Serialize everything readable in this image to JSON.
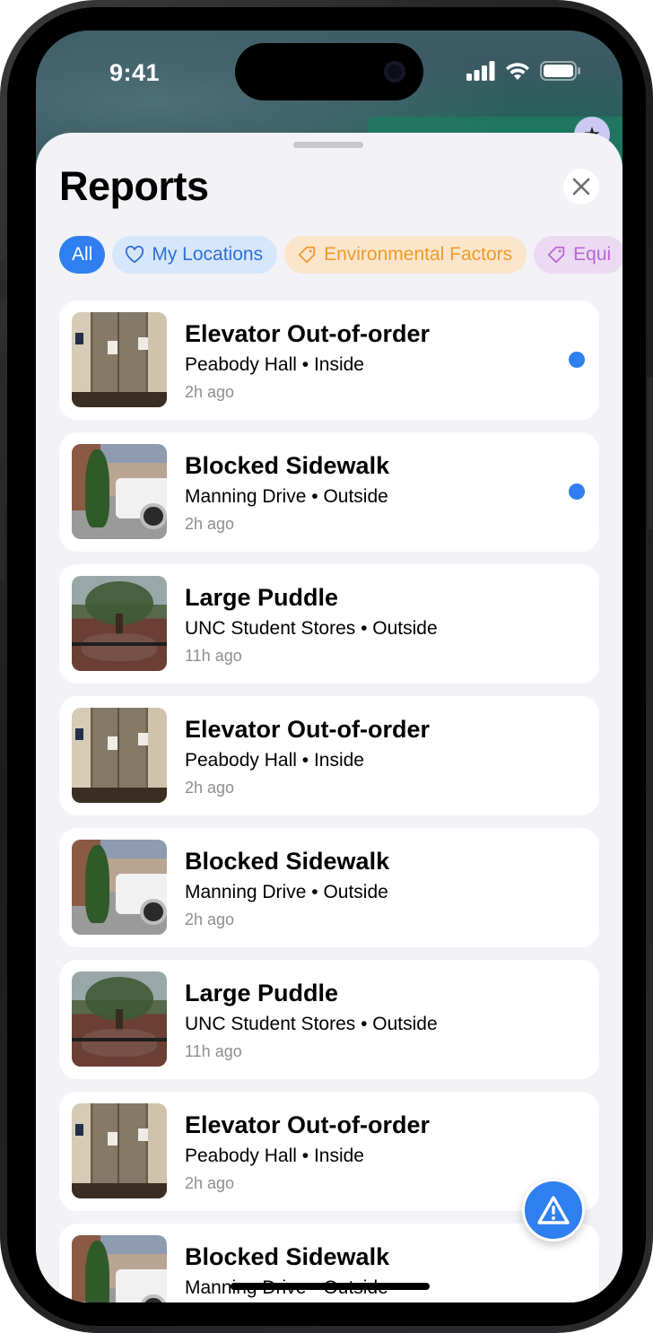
{
  "status_bar": {
    "time": "9:41"
  },
  "sheet": {
    "title": "Reports"
  },
  "filters": [
    {
      "label": "All",
      "selected": true,
      "icon": "none",
      "color": "#2f7ff0"
    },
    {
      "label": "My Locations",
      "selected": false,
      "icon": "heart-icon",
      "color": "#2f6fd8"
    },
    {
      "label": "Environmental Factors",
      "selected": false,
      "icon": "tag-icon",
      "color": "#ef9a2b"
    },
    {
      "label": "Equi",
      "selected": false,
      "icon": "tag-icon",
      "color": "#b668d6"
    }
  ],
  "reports": [
    {
      "title": "Elevator Out-of-order",
      "location": "Peabody Hall",
      "place": "Inside",
      "time": "2h ago",
      "unread": true,
      "thumbnail": "elevator"
    },
    {
      "title": "Blocked Sidewalk",
      "location": "Manning Drive",
      "place": "Outside",
      "time": "2h ago",
      "unread": true,
      "thumbnail": "sidewalk"
    },
    {
      "title": "Large Puddle",
      "location": "UNC Student Stores",
      "place": "Outside",
      "time": "11h ago",
      "unread": false,
      "thumbnail": "puddle"
    },
    {
      "title": "Elevator Out-of-order",
      "location": "Peabody Hall",
      "place": "Inside",
      "time": "2h ago",
      "unread": false,
      "thumbnail": "elevator"
    },
    {
      "title": "Blocked Sidewalk",
      "location": "Manning Drive",
      "place": "Outside",
      "time": "2h ago",
      "unread": false,
      "thumbnail": "sidewalk"
    },
    {
      "title": "Large Puddle",
      "location": "UNC Student Stores",
      "place": "Outside",
      "time": "11h ago",
      "unread": false,
      "thumbnail": "puddle"
    },
    {
      "title": "Elevator Out-of-order",
      "location": "Peabody Hall",
      "place": "Inside",
      "time": "2h ago",
      "unread": false,
      "thumbnail": "elevator"
    },
    {
      "title": "Blocked Sidewalk",
      "location": "Manning Drive",
      "place": "Outside",
      "time": "",
      "unread": false,
      "thumbnail": "sidewalk"
    }
  ],
  "fab": {
    "icon": "warning-triangle-icon"
  },
  "colors": {
    "accent": "#2f7ff0",
    "sheet_background": "#f2f2f7"
  }
}
